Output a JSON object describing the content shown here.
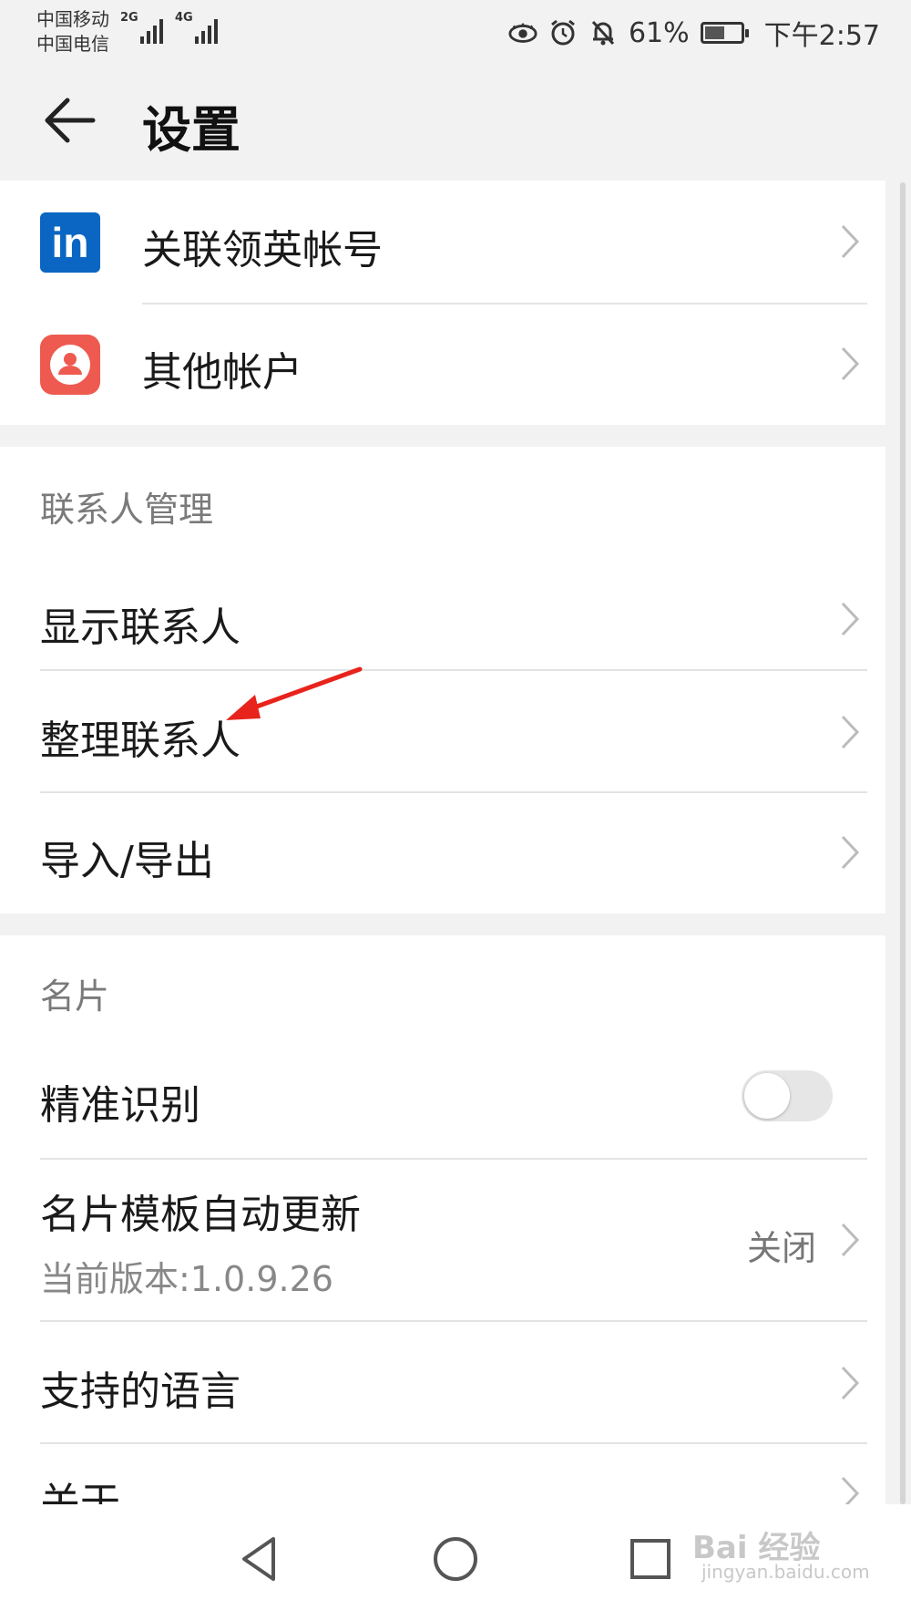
{
  "status_bar": {
    "carrier1": "中国移动",
    "carrier2": "中国电信",
    "net1": "2G",
    "net2": "4G",
    "battery_percent": "61%",
    "battery_level": 0.61,
    "time": "下午2:57",
    "icons": [
      "eye-icon",
      "alarm-icon",
      "mute-bell-icon",
      "battery-icon"
    ]
  },
  "header": {
    "title": "设置"
  },
  "accounts": {
    "items": [
      {
        "label": "关联领英帐号",
        "icon": "linkedin-icon",
        "logo_text": "in"
      },
      {
        "label": "其他帐户",
        "icon": "account-icon"
      }
    ]
  },
  "contact_management": {
    "title": "联系人管理",
    "items": [
      {
        "label": "显示联系人"
      },
      {
        "label": "整理联系人"
      },
      {
        "label": "导入/导出"
      }
    ]
  },
  "business_card": {
    "title": "名片",
    "precise_recognition": {
      "label": "精准识别",
      "enabled": false
    },
    "template_update": {
      "label": "名片模板自动更新",
      "subtitle": "当前版本:1.0.9.26",
      "value": "关闭"
    },
    "languages": {
      "label": "支持的语言"
    },
    "about": {
      "label": "关于"
    }
  },
  "watermark": {
    "text": "Bai 经验",
    "subtext": "jingyan.baidu.com"
  },
  "colors": {
    "linkedin_blue": "#0a66c2",
    "account_red": "#ee5a4f",
    "annotation_arrow": "#e8231c"
  }
}
